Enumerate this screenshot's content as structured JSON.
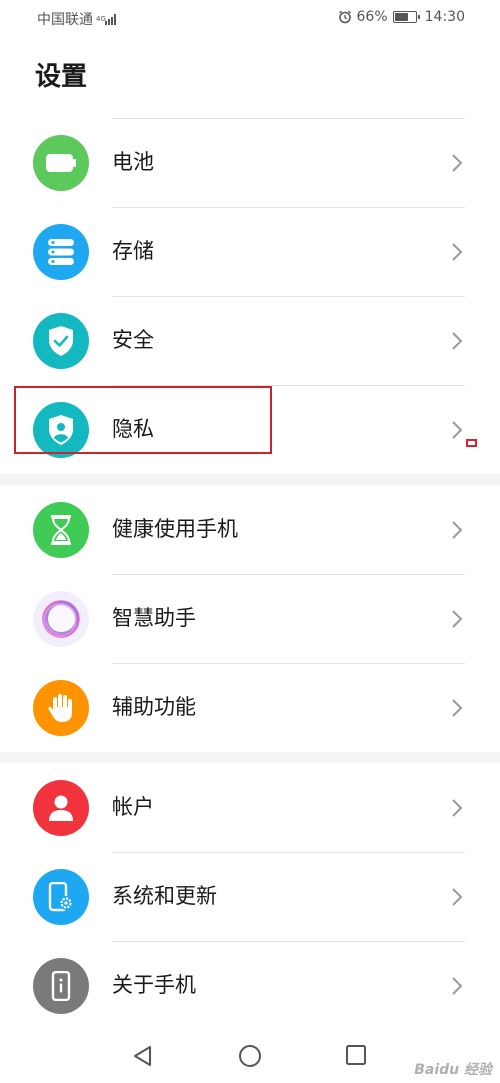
{
  "status_bar": {
    "carrier": "中国联通",
    "network_type": "4G",
    "battery_percent": "66%",
    "battery_level": 0.66,
    "time": "14:30"
  },
  "page_title": "设置",
  "groups": [
    {
      "items": [
        {
          "label": "电池",
          "icon": "battery-icon",
          "color": "#5bc95c"
        },
        {
          "label": "存储",
          "icon": "storage-icon",
          "color": "#1ea8f2"
        },
        {
          "label": "安全",
          "icon": "shield-check-icon",
          "color": "#14b8c0"
        },
        {
          "label": "隐私",
          "icon": "privacy-shield-icon",
          "color": "#14b8c0"
        }
      ]
    },
    {
      "items": [
        {
          "label": "健康使用手机",
          "icon": "hourglass-icon",
          "color": "#3fcb55"
        },
        {
          "label": "智慧助手",
          "icon": "assistant-ring-icon",
          "color": "#f3eefb"
        },
        {
          "label": "辅助功能",
          "icon": "hand-icon",
          "color": "#ff9300"
        }
      ]
    },
    {
      "items": [
        {
          "label": "帐户",
          "icon": "user-icon",
          "color": "#f0333d"
        },
        {
          "label": "系统和更新",
          "icon": "phone-gear-icon",
          "color": "#1ea8f2"
        },
        {
          "label": "关于手机",
          "icon": "phone-info-icon",
          "color": "#7a7a7a"
        }
      ]
    }
  ],
  "nav": {
    "back": "back-icon",
    "home": "home-icon",
    "recents": "recents-icon"
  },
  "watermark": "Baidu 经验"
}
